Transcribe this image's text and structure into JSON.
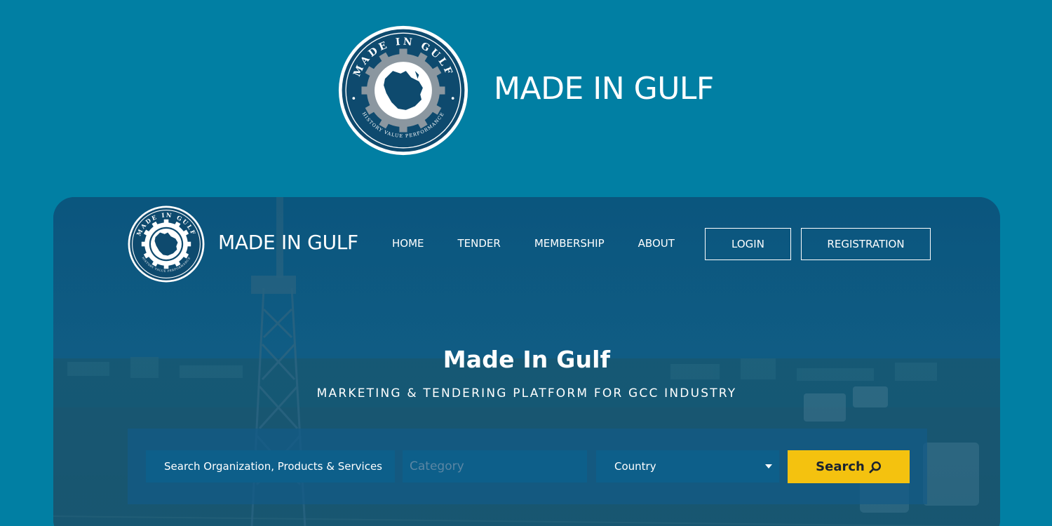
{
  "brand": {
    "name": "MADE IN GULF",
    "seal_top_text": "MADE IN GULF",
    "seal_bottom_text": "HISTORY VALUE PERFORMANCE"
  },
  "nav": {
    "logo_text": "MADE IN GULF",
    "items": [
      {
        "label": "HOME"
      },
      {
        "label": "TENDER"
      },
      {
        "label": "MEMBERSHIP"
      },
      {
        "label": "ABOUT"
      }
    ],
    "login_label": "LOGIN",
    "register_label": "REGISTRATION"
  },
  "hero": {
    "title": "Made In Gulf",
    "subtitle": "MARKETING & TENDERING PLATFORM FOR GCC INDUSTRY"
  },
  "search": {
    "org_placeholder": "Search Organization, Products & Services",
    "category_placeholder": "Category",
    "country_value": "Country",
    "button_label": "Search"
  },
  "colors": {
    "background": "#017fa3",
    "seal_navy": "#0e4a6e",
    "search_button": "#f4c20f",
    "field_bg": "#0d5f8a"
  }
}
